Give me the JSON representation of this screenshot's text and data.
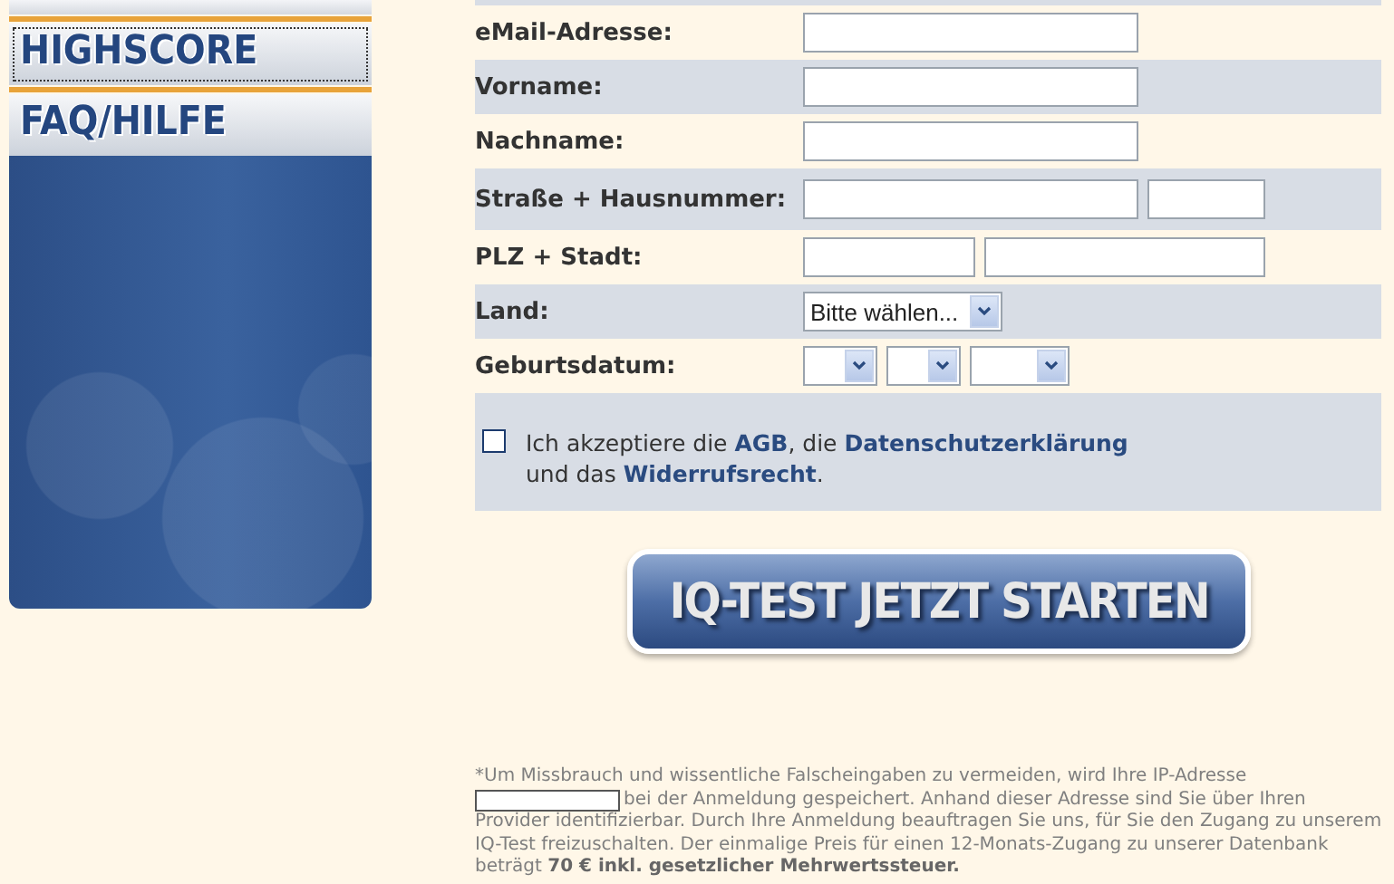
{
  "sidebar": {
    "items": [
      {
        "label": "HIGHSCORE",
        "selected": true
      },
      {
        "label": "FAQ/HILFE",
        "selected": false
      }
    ]
  },
  "form": {
    "rows": [
      {
        "kind": "single",
        "label": "eMail-Adresse:"
      },
      {
        "kind": "single",
        "label": "Vorname:"
      },
      {
        "kind": "single",
        "label": "Nachname:"
      },
      {
        "kind": "street",
        "label": "Straße + Hausnummer:"
      },
      {
        "kind": "city",
        "label": "PLZ + Stadt:"
      },
      {
        "kind": "select",
        "label": "Land:",
        "value": "Bitte wählen..."
      },
      {
        "kind": "date",
        "label": "Geburtsdatum:"
      }
    ],
    "consent": {
      "checked": false,
      "parts": [
        {
          "kind": "text",
          "text": "Ich akzeptiere die"
        },
        {
          "kind": "link",
          "text": "AGB"
        },
        {
          "kind": "text",
          "text": ", die"
        },
        {
          "kind": "link",
          "text": "Datenschutzerklärung"
        },
        {
          "kind": "break"
        },
        {
          "kind": "text",
          "text": "und das"
        },
        {
          "kind": "link",
          "text": "Widerrufsrecht"
        },
        {
          "kind": "text",
          "text": "."
        }
      ]
    }
  },
  "start_button": {
    "label": "IQ-TEST JETZT STARTEN"
  },
  "footnote": {
    "before": "*Um Missbrauch und wissentliche Falscheingaben zu vermeiden, wird Ihre IP-Adresse",
    "after_line": "bei der Anmeldung gespeichert. Anhand dieser Adresse sind Sie über Ihren",
    "rest": "Provider identifizierbar. Durch Ihre Anmeldung beauftragen Sie uns, für Sie den Zugang zu unserem IQ-Test freizuschalten. Der einmalige Preis für einen 12-Monats-Zugang zu unserer Datenbank beträgt **70 € inkl. gesetzlicher Mehrwertssteuer.**"
  }
}
